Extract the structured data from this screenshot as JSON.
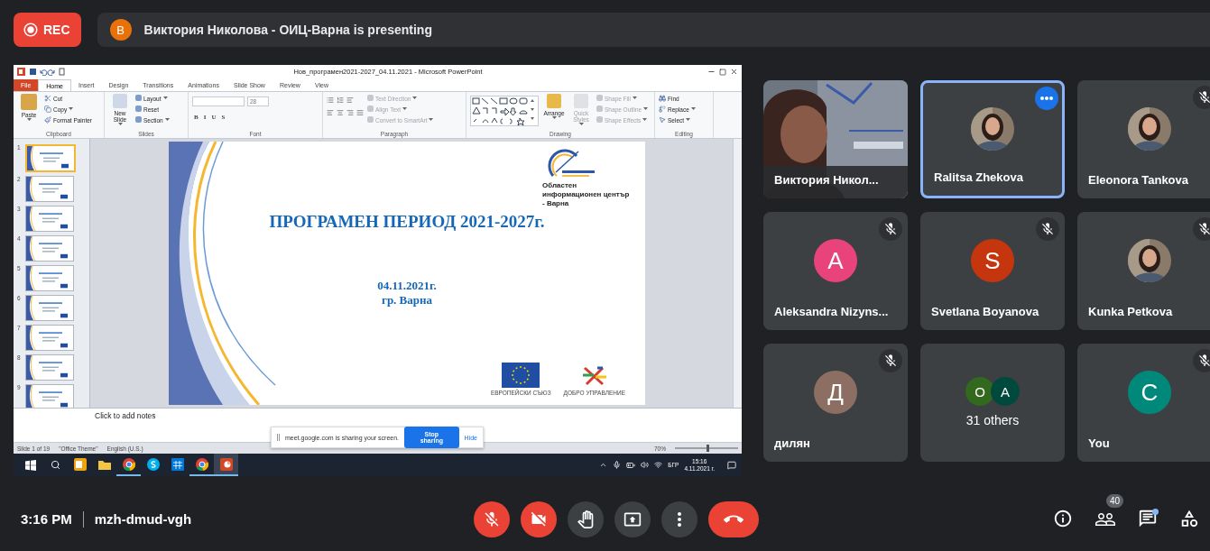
{
  "recording": {
    "label": "REC",
    "on": true
  },
  "presenter_banner": {
    "avatar": "В",
    "text": "Виктория Николова - ОИЦ-Варна is presenting"
  },
  "shared_screen": {
    "window": {
      "title": "Нов_програмен2021-2027_04.11.2021 - Microsoft PowerPoint"
    },
    "tabs": [
      {
        "label": "File",
        "kind": "file",
        "selected": false
      },
      {
        "label": "Home",
        "kind": "tab",
        "selected": true
      },
      {
        "label": "Insert",
        "kind": "tab",
        "selected": false
      },
      {
        "label": "Design",
        "kind": "tab",
        "selected": false
      },
      {
        "label": "Transitions",
        "kind": "tab",
        "selected": false
      },
      {
        "label": "Animations",
        "kind": "tab",
        "selected": false
      },
      {
        "label": "Slide Show",
        "kind": "tab",
        "selected": false
      },
      {
        "label": "Review",
        "kind": "tab",
        "selected": false
      },
      {
        "label": "View",
        "kind": "tab",
        "selected": false
      }
    ],
    "ribbon_groups": [
      {
        "label": "Clipboard",
        "kind": "clipboard",
        "large": {
          "label": "Paste",
          "menu": true,
          "disabled": false
        },
        "items": [
          {
            "label": "Cut",
            "menu": false,
            "disabled": false
          },
          {
            "label": "Copy",
            "menu": true,
            "disabled": false
          },
          {
            "label": "Format Painter",
            "menu": false,
            "disabled": false
          }
        ]
      },
      {
        "label": "Slides",
        "kind": "slides",
        "large": {
          "label": "New Slide",
          "menu": true,
          "disabled": false
        },
        "items": [
          {
            "label": "Layout",
            "menu": true,
            "disabled": false
          },
          {
            "label": "Reset",
            "menu": false,
            "disabled": false
          },
          {
            "label": "Section",
            "menu": true,
            "disabled": false
          }
        ]
      },
      {
        "label": "Font",
        "kind": "font",
        "font_size": "28",
        "format_buttons": [
          "B",
          "I",
          "U",
          "S"
        ]
      },
      {
        "label": "Paragraph",
        "kind": "paragraph",
        "items": [
          {
            "label": "Text Direction",
            "menu": true,
            "disabled": true
          },
          {
            "label": "Align Text",
            "menu": true,
            "disabled": true
          },
          {
            "label": "Convert to SmartArt",
            "menu": true,
            "disabled": true
          }
        ]
      },
      {
        "label": "Drawing",
        "kind": "drawing",
        "large": {
          "label": "Arrange",
          "menu": true,
          "disabled": false
        },
        "large_2": {
          "label": "Quick Styles",
          "menu": true,
          "disabled": true
        },
        "items": [
          {
            "label": "Shape Fill",
            "menu": true,
            "disabled": true
          },
          {
            "label": "Shape Outline",
            "menu": true,
            "disabled": true
          },
          {
            "label": "Shape Effects",
            "menu": true,
            "disabled": true
          }
        ]
      },
      {
        "label": "Editing",
        "kind": "editing",
        "items": [
          {
            "label": "Find",
            "menu": false,
            "disabled": false
          },
          {
            "label": "Replace",
            "menu": true,
            "disabled": false
          },
          {
            "label": "Select",
            "menu": true,
            "disabled": false
          }
        ]
      }
    ],
    "thumbnails": [
      {
        "number": "1",
        "selected": true
      },
      {
        "number": "2",
        "selected": false
      },
      {
        "number": "3",
        "selected": false
      },
      {
        "number": "4",
        "selected": false
      },
      {
        "number": "5",
        "selected": false
      },
      {
        "number": "6",
        "selected": false
      },
      {
        "number": "7",
        "selected": false
      },
      {
        "number": "8",
        "selected": false
      },
      {
        "number": "9",
        "selected": false
      }
    ],
    "slide": {
      "org_caption": "Областен информационен център - Варна",
      "title": "ПРОГРАМЕН ПЕРИОД 2021-2027г.",
      "date": "04.11.2021г.",
      "city": "гр. Варна",
      "eu_caption": "ЕВРОПЕЙСКИ СЪЮЗ",
      "program_caption": "ДОБРО УПРАВЛЕНИЕ"
    },
    "notes": {
      "placeholder": "Click to add notes"
    },
    "share_notice": {
      "text": "meet.google.com is sharing your screen.",
      "stop": "Stop sharing",
      "hide": "Hide"
    },
    "status_bar": {
      "slide": "Slide 1 of 19",
      "theme": "\"Office Theme\"",
      "language": "English (U.S.)",
      "zoom": "70%",
      "level": 0.5
    },
    "taskbar": {
      "apps": [
        {
          "kind": "outlook",
          "running": false,
          "active": false
        },
        {
          "kind": "explorer",
          "running": false,
          "active": false
        },
        {
          "kind": "chrome",
          "running": true,
          "active": false
        },
        {
          "kind": "skype",
          "running": false,
          "active": false
        },
        {
          "kind": "calendar",
          "running": false,
          "active": false
        },
        {
          "kind": "chrome",
          "running": true,
          "active": false
        },
        {
          "kind": "powerpoint",
          "running": true,
          "active": true
        }
      ],
      "language": "БГР",
      "time": "15:16",
      "date": "4.11.2021 г."
    }
  },
  "tiles": [
    {
      "name": "Виктория Никол...",
      "kind": "video",
      "muted": false,
      "selected": false
    },
    {
      "name": "Ralitsa Zhekova",
      "muted": false,
      "selected": true
    },
    {
      "name": "Eleonora Tankova",
      "muted": true,
      "selected": false
    },
    {
      "name": "Aleksandra Nizyns...",
      "kind": "letter",
      "letter": "A",
      "color": "#e8437a",
      "muted": true,
      "selected": false
    },
    {
      "name": "Svetlana Boyanova",
      "kind": "letter",
      "letter": "S",
      "color": "#c5360f",
      "muted": true,
      "selected": false
    },
    {
      "name": "Kunka Petkova",
      "muted": true,
      "selected": false
    },
    {
      "name": "дилян",
      "kind": "letter",
      "letter": "Д",
      "color": "#8d6e63",
      "muted": true,
      "selected": false
    },
    {
      "name": "31 others",
      "kind": "others",
      "avatars": [
        {
          "letter": "O",
          "color": "#33691e"
        },
        {
          "letter": "A",
          "color": "#00493d"
        }
      ],
      "muted": false,
      "selected": false
    },
    {
      "name": "You",
      "kind": "letter",
      "letter": "C",
      "color": "#00897b",
      "muted": true,
      "selected": false
    }
  ],
  "footer": {
    "time": "3:16 PM",
    "meeting_code": "mzh-dmud-vgh",
    "controls": [
      {
        "kind": "mic",
        "on": false
      },
      {
        "kind": "camera",
        "on": false
      },
      {
        "kind": "hand",
        "on": false
      },
      {
        "kind": "present",
        "on": false
      },
      {
        "kind": "more",
        "on": false
      },
      {
        "kind": "leave",
        "on": false
      }
    ],
    "people_count": "40",
    "chat_unread": true
  }
}
